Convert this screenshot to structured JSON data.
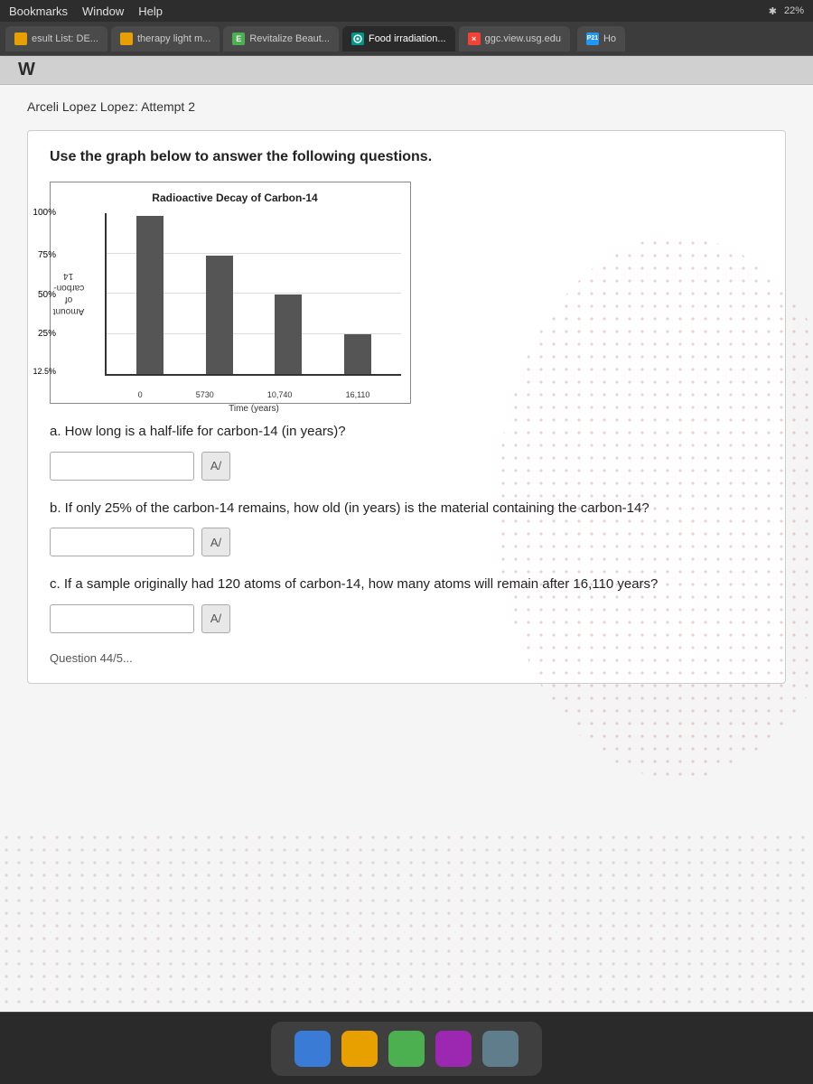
{
  "menubar": {
    "items": [
      "Bookmarks",
      "Window",
      "Help"
    ]
  },
  "browser": {
    "tabs": [
      {
        "id": "result-list",
        "label": "esult List: DE...",
        "icon_type": "orange",
        "icon_text": ""
      },
      {
        "id": "therapy",
        "label": "therapy light m...",
        "icon_type": "orange",
        "icon_text": ""
      },
      {
        "id": "revitalize",
        "label": "Revitalize Beaut...",
        "icon_type": "green",
        "icon_text": "E"
      },
      {
        "id": "food-irradiation",
        "label": "Food irradiation...",
        "icon_type": "teal",
        "icon_text": ""
      },
      {
        "id": "ggc",
        "label": "ggc.view.usg.edu",
        "icon_type": "red",
        "icon_text": "×"
      },
      {
        "id": "extra",
        "label": "Ho",
        "icon_type": "blue",
        "icon_text": "P21"
      }
    ],
    "battery": "22%"
  },
  "page": {
    "logo": "W",
    "attempt_label": "Arceli Lopez Lopez: Attempt 2",
    "instruction": "Use the graph below to answer the following questions.",
    "chart": {
      "title": "Radioactive Decay of Carbon-14",
      "y_axis_title": "Amount\nof\ncarbon-\n14",
      "y_labels": [
        "100%",
        "75%",
        "50%",
        "25%",
        "12.5%"
      ],
      "x_labels": [
        "0",
        "5730",
        "10,740",
        "16,110"
      ],
      "x_axis_title": "Time (years)",
      "bars": [
        {
          "label": "0",
          "height_pct": 100
        },
        {
          "label": "5730",
          "height_pct": 75
        },
        {
          "label": "10740",
          "height_pct": 50
        },
        {
          "label": "16110",
          "height_pct": 25
        }
      ]
    },
    "questions": [
      {
        "id": "q_a",
        "text": "a. How long is a half-life for carbon-14 (in years)?",
        "answer": "",
        "format_btn": "A/"
      },
      {
        "id": "q_b",
        "text": "b. If only 25% of the carbon-14 remains, how old (in years) is the material containing the carbon-14?",
        "answer": "",
        "format_btn": "A/"
      },
      {
        "id": "q_c",
        "text": "c. If a sample originally had 120 atoms of carbon-14, how many atoms will remain after 16,110 years?",
        "answer": "",
        "format_btn": "A/"
      }
    ],
    "next_question_hint": "Question 44/5..."
  }
}
